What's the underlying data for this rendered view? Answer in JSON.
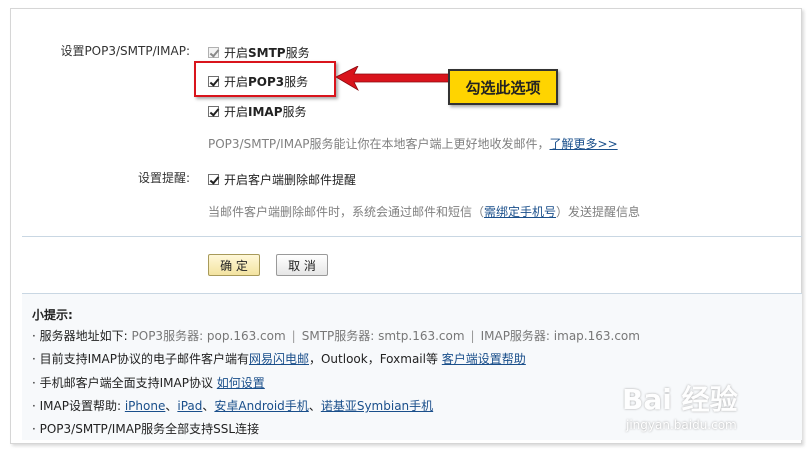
{
  "settings": {
    "label": "设置POP3/SMTP/IMAP:",
    "options": [
      {
        "prefix": "开启",
        "bold": "SMTP",
        "suffix": "服务"
      },
      {
        "prefix": "开启",
        "bold": "POP3",
        "suffix": "服务"
      },
      {
        "prefix": "开启",
        "bold": "IMAP",
        "suffix": "服务"
      }
    ],
    "hint": "POP3/SMTP/IMAP服务能让你在本地客户端上更好地收发邮件，",
    "hint_link": "了解更多>>"
  },
  "reminder": {
    "label": "设置提醒:",
    "option": "开启客户端删除邮件提醒",
    "hint_prefix": "当邮件客户端删除邮件时，系统会通过邮件和短信（",
    "hint_link": "需绑定手机号",
    "hint_suffix": "）发送提醒信息"
  },
  "annotation": {
    "callout": "勾选此选项",
    "accent": "#d9141c",
    "callout_bg": "#ffd400"
  },
  "buttons": {
    "confirm": "确 定",
    "cancel": "取 消"
  },
  "tips": {
    "title": "小提示:",
    "server_prefix": "· 服务器地址如下:",
    "pop3": "POP3服务器: pop.163.com",
    "smtp": "SMTP服务器: smtp.163.com",
    "imap": "IMAP服务器: imap.163.com",
    "sep": "|",
    "client_prefix": "· 目前支持IMAP协议的电子邮件客户端有",
    "client_link1": "网易闪电邮",
    "client_mid": "，Outlook，Foxmail等",
    "client_link2": "客户端设置帮助",
    "mobile_prefix": "· 手机邮客户端全面支持IMAP协议",
    "mobile_link": "如何设置",
    "imap_help_prefix": "· IMAP设置帮助:",
    "help_links": [
      "iPhone",
      "iPad",
      "安卓Android手机",
      "诺基亚Symbian手机"
    ],
    "help_sep": "、",
    "ssl": "· POP3/SMTP/IMAP服务全部支持SSL连接"
  },
  "watermark": {
    "main": "Bai 经验",
    "sub": "jingyan.baidu.com"
  }
}
